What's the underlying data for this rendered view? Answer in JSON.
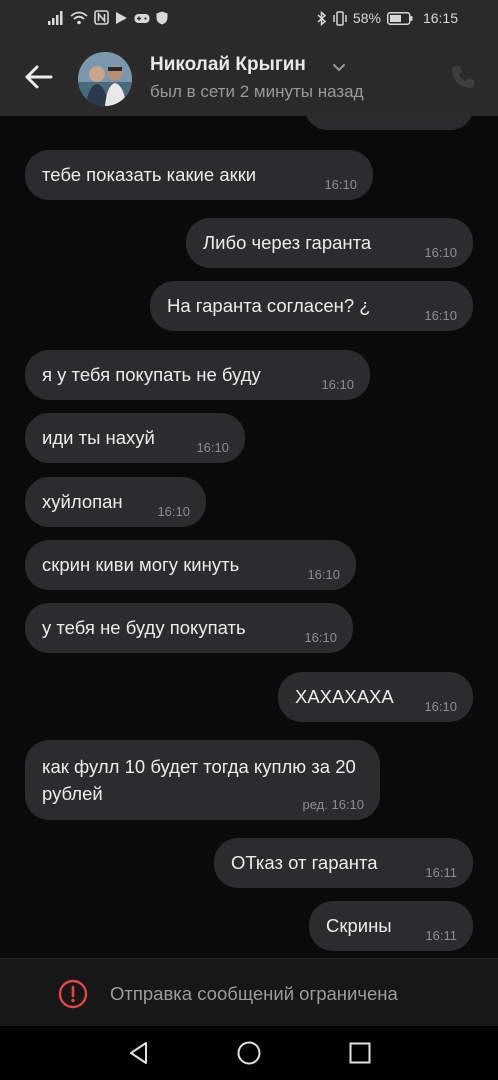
{
  "status_bar": {
    "battery_percent": "58%",
    "time": "16:15",
    "icons": [
      "signal-icon",
      "wifi-icon",
      "nfc-icon",
      "play-icon",
      "gamepad-icon",
      "shield-icon",
      "bluetooth-icon",
      "vibrate-icon",
      "battery-icon"
    ]
  },
  "header": {
    "contact_name": "Николай Крыгин",
    "contact_status": "был в сети 2 минуты назад",
    "icons": [
      "back-arrow-icon",
      "chevron-down-icon",
      "phone-icon"
    ]
  },
  "messages": [
    {
      "direction": "in",
      "text": "тебе показать какие акки",
      "time": "16:10"
    },
    {
      "direction": "out",
      "text": "Либо через гаранта",
      "time": "16:10"
    },
    {
      "direction": "out",
      "text": "На гаранта согласен? ¿",
      "time": "16:10"
    },
    {
      "direction": "in",
      "text": "я у тебя покупать не буду",
      "time": "16:10"
    },
    {
      "direction": "in",
      "text": "иди ты нахуй",
      "time": "16:10"
    },
    {
      "direction": "in",
      "text": "хуйлопан",
      "time": "16:10"
    },
    {
      "direction": "in",
      "text": "скрин киви могу кинуть",
      "time": "16:10"
    },
    {
      "direction": "in",
      "text": "у тебя не буду покупать",
      "time": "16:10"
    },
    {
      "direction": "out",
      "text": "ХАХАХАХА",
      "time": "16:10"
    },
    {
      "direction": "in",
      "text": "как фулл 10 будет тогда куплю за 20 рублей",
      "time": "ред. 16:10"
    },
    {
      "direction": "out",
      "text": "ОТказ от гаранта",
      "time": "16:11"
    },
    {
      "direction": "out",
      "text": "Скрины",
      "time": "16:11"
    }
  ],
  "restricted": {
    "text": "Отправка сообщений ограничена",
    "icon": "alert-circle-icon",
    "accent_color": "#e64646"
  },
  "nav_bar": {
    "icons": [
      "back-triangle-icon",
      "home-circle-icon",
      "recents-square-icon"
    ]
  },
  "colors": {
    "background": "#0a0a0a",
    "header": "#2a2a2b",
    "bubble": "#2c2c2e"
  }
}
